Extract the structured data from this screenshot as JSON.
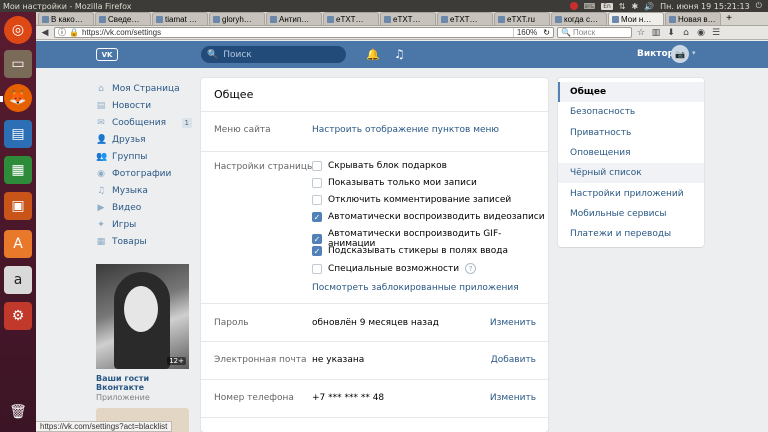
{
  "os": {
    "window_title": "Мои настройки - Mozilla Firefox",
    "tray_lang": "En",
    "tray_datetime": "Пн. июня 19 15:21:13"
  },
  "browser": {
    "tabs": [
      {
        "label": "В како…",
        "active": false
      },
      {
        "label": "Сведе…",
        "active": false
      },
      {
        "label": "tiamat …",
        "active": false
      },
      {
        "label": "gloryh…",
        "active": false
      },
      {
        "label": "Антип…",
        "active": false
      },
      {
        "label": "eTXT…",
        "active": false
      },
      {
        "label": "eTXT…",
        "active": false
      },
      {
        "label": "eTXT…",
        "active": false
      },
      {
        "label": "eTXT.ru",
        "active": false
      },
      {
        "label": "когда с…",
        "active": false
      },
      {
        "label": "Мои н…",
        "active": true
      },
      {
        "label": "Новая в…",
        "active": false
      }
    ],
    "url": "https://vk.com/settings",
    "zoom": "160%",
    "search_placeholder": "Поиск",
    "status_url": "https://vk.com/settings?act=blacklist"
  },
  "vk": {
    "logo": "VK",
    "search_placeholder": "Поиск",
    "user_name": "Виктор"
  },
  "left_nav": [
    {
      "label": "Моя Страница",
      "icon": "home-icon",
      "glyph": "⌂"
    },
    {
      "label": "Новости",
      "icon": "news-icon",
      "glyph": "▤"
    },
    {
      "label": "Сообщения",
      "icon": "messages-icon",
      "glyph": "✉",
      "count": "1"
    },
    {
      "label": "Друзья",
      "icon": "friends-icon",
      "glyph": "👤"
    },
    {
      "label": "Группы",
      "icon": "groups-icon",
      "glyph": "👥"
    },
    {
      "label": "Фотографии",
      "icon": "photos-icon",
      "glyph": "◉"
    },
    {
      "label": "Музыка",
      "icon": "music-icon",
      "glyph": "♫"
    },
    {
      "label": "Видео",
      "icon": "video-icon",
      "glyph": "▶"
    },
    {
      "label": "Игры",
      "icon": "games-icon",
      "glyph": "✦"
    },
    {
      "label": "Товары",
      "icon": "market-icon",
      "glyph": "▦"
    }
  ],
  "app_widget": {
    "badge": "12+",
    "name": "Ваши гости Вконтакте",
    "subtitle": "Приложение"
  },
  "settings": {
    "title": "Общее",
    "site_menu": {
      "label": "Меню сайта",
      "link": "Настроить отображение пунктов меню"
    },
    "page_settings": {
      "label": "Настройки страницы",
      "options": [
        {
          "label": "Скрывать блок подарков",
          "checked": false
        },
        {
          "label": "Показывать только мои записи",
          "checked": false
        },
        {
          "label": "Отключить комментирование записей",
          "checked": false
        },
        {
          "label": "Автоматически воспроизводить видеозаписи",
          "checked": true
        },
        {
          "label": "Автоматически воспроизводить GIF-анимации",
          "checked": true
        },
        {
          "label": "Подсказывать стикеры в полях ввода",
          "checked": true
        },
        {
          "label": "Специальные возможности",
          "checked": false,
          "help": "?"
        }
      ],
      "blocked_apps_link": "Посмотреть заблокированные приложения"
    },
    "password": {
      "label": "Пароль",
      "value": "обновлён 9 месяцев назад",
      "action": "Изменить"
    },
    "email": {
      "label": "Электронная почта",
      "value": "не указана",
      "action": "Добавить"
    },
    "phone": {
      "label": "Номер телефона",
      "value": "+7 *** *** ** 48",
      "action": "Изменить"
    }
  },
  "right_nav": [
    {
      "label": "Общее",
      "active": true
    },
    {
      "label": "Безопасность"
    },
    {
      "label": "Приватность"
    },
    {
      "label": "Оповещения"
    },
    {
      "label": "Чёрный список",
      "hover": true
    },
    {
      "label": "Настройки приложений"
    },
    {
      "label": "Мобильные сервисы"
    },
    {
      "label": "Платежи и переводы"
    }
  ]
}
